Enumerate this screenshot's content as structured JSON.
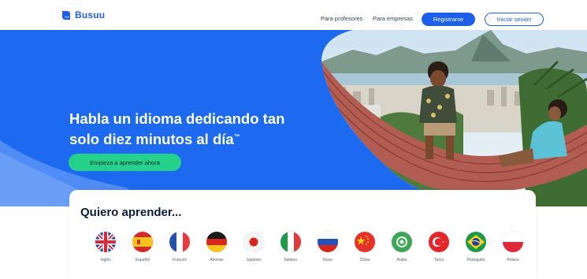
{
  "header": {
    "logo_text": "Busuu",
    "nav_teachers": "Para profesores",
    "nav_business": "Para empresas",
    "register_label": "Registrarse",
    "login_label": "Iniciar sesión"
  },
  "hero": {
    "headline": "Habla un idioma dedicando tan solo diez minutos al día",
    "trademark": "™",
    "cta_label": "Empieza a aprender ahora",
    "photo_icon": "people-hammock-photo"
  },
  "learn": {
    "title": "Quiero aprender...",
    "languages": [
      {
        "label": "Inglés",
        "icon": "uk-flag-icon"
      },
      {
        "label": "Español",
        "icon": "spain-flag-icon"
      },
      {
        "label": "Francés",
        "icon": "france-flag-icon"
      },
      {
        "label": "Alemán",
        "icon": "germany-flag-icon"
      },
      {
        "label": "Japonés",
        "icon": "japan-flag-icon"
      },
      {
        "label": "Italiano",
        "icon": "italy-flag-icon"
      },
      {
        "label": "Ruso",
        "icon": "russia-flag-icon"
      },
      {
        "label": "Chino",
        "icon": "china-flag-icon"
      },
      {
        "label": "Árabe",
        "icon": "arabic-flag-icon"
      },
      {
        "label": "Turco",
        "icon": "turkey-flag-icon"
      },
      {
        "label": "Portugués",
        "icon": "brazil-flag-icon"
      },
      {
        "label": "Polaco",
        "icon": "poland-flag-icon"
      }
    ]
  },
  "colors": {
    "brand_blue": "#1d6af0",
    "cta_green": "#25d08a",
    "text_dark": "#0c1b3a"
  }
}
